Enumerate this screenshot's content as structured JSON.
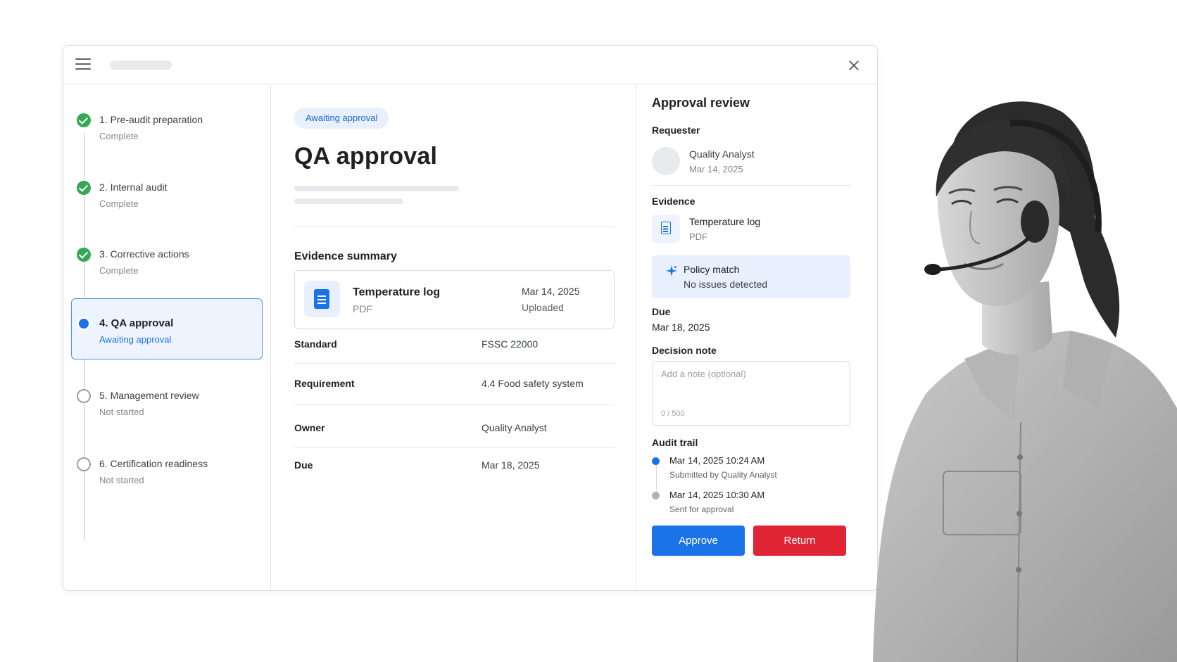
{
  "steps": [
    {
      "title": "1. Pre-audit preparation",
      "status": "Complete",
      "state": "done"
    },
    {
      "title": "2. Internal audit",
      "status": "Complete",
      "state": "done"
    },
    {
      "title": "3. Corrective actions",
      "status": "Complete",
      "state": "done"
    },
    {
      "title": "4. QA approval",
      "status": "Awaiting approval",
      "state": "current"
    },
    {
      "title": "5. Management review",
      "status": "Not started",
      "state": "todo"
    },
    {
      "title": "6. Certification readiness",
      "status": "Not started",
      "state": "todo"
    }
  ],
  "main": {
    "badge": "Awaiting approval",
    "title": "QA approval",
    "evidence_heading": "Evidence summary",
    "evidence": {
      "name": "Temperature log",
      "type": "PDF",
      "date": "Mar 14, 2025",
      "status": "Uploaded"
    },
    "details": [
      {
        "key": "Standard",
        "value": "FSSC 22000"
      },
      {
        "key": "Requirement",
        "value": "4.4 Food safety system"
      },
      {
        "key": "Owner",
        "value": "Quality Analyst"
      },
      {
        "key": "Due",
        "value": "Mar 18, 2025"
      }
    ]
  },
  "panel": {
    "title": "Approval review",
    "requester_label": "Requester",
    "requester_name": "Quality Analyst",
    "requester_date": "Mar 14, 2025",
    "evidence_label": "Evidence",
    "file_name": "Temperature log",
    "file_type": "PDF",
    "policy_title": "Policy match",
    "policy_sub": "No issues detected",
    "due_label": "Due",
    "due_value": "Mar 18, 2025",
    "note_label": "Decision note",
    "note_placeholder": "Add a note (optional)",
    "note_count": "0 / 500",
    "trail_label": "Audit trail",
    "trail": [
      {
        "time": "Mar 14, 2025  10:24 AM",
        "desc": "Submitted by Quality Analyst",
        "color": "#1a73e8"
      },
      {
        "time": "Mar 14, 2025  10:30 AM",
        "desc": "Sent for approval",
        "color": "#b0b3b8"
      }
    ],
    "approve_label": "Approve",
    "return_label": "Return"
  },
  "colors": {
    "accent": "#1a73e8",
    "success": "#34a853",
    "danger": "#e02433"
  }
}
